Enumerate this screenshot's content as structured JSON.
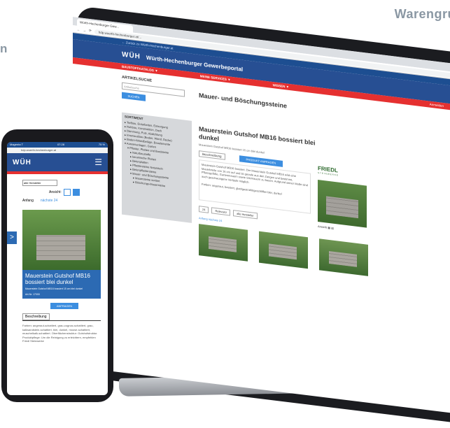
{
  "background": {
    "word": "Warengru",
    "letter": "n"
  },
  "desktop": {
    "tab_title": "Würth-Hechenburger Gew...",
    "url": "hdp.wuerth-hechenburger.at/...",
    "topnav_link": "Zurück zu Würth-Hechenburger.at",
    "logo": "WÜH",
    "portal_title": "Würth-Hechenburger Gewerbeportal",
    "menu": [
      "BAUSTOFFKATALOG ▼",
      "MEINE SERVICES ▼",
      "WISSEN ▼"
    ],
    "menu_right": "Anmelden",
    "sidebar": {
      "search_heading": "ARTIKELSUCHE",
      "search_placeholder": "Artikelsuche",
      "search_button": "SUCHEN",
      "sortiment_heading": "SORTIMENT",
      "sortiment_items": [
        "Tiefbau, Erdarbeiten, Entsorgung",
        "Rohbau, Konstruktion, Dach",
        "Dämmung, Putz, Abdichtung",
        "Innenausbau (Boden, Wand, Decke)",
        "Boden-/Wandbeläge, Bauelemente",
        "Aussenanlagen, Garten",
        "Pflaster, Platten und Bordsteine",
        "Naturbaustoffe",
        "keramische Platten",
        "Betonplatten",
        "Pflastersteine Naturstein",
        "Betonpflastersteine",
        "Mauer- und Böschungssteine",
        "Mauersteine sortiert",
        "Böschungs-Mauersteine"
      ]
    },
    "main": {
      "category_title": "Mauer- und Böschungssteine",
      "product_title": "Mauerstein Gutshof MB16 bossiert blei dunkel",
      "product_sub": "Mauerstein Gutshof MB16 bossiert 15 cm blei dunkel",
      "tab_description": "Beschreibung",
      "anfrage_button": "PRODUKT ANFRAGEN",
      "description": "Mauerstein Gutshof MB16 bossiert. Der Mauerstein Gutshof MB16 wird eine Mauerbreite von 16 cm auf und ist gerade aus den Zangen und bestimmt, Pflanzgefäße, Gartenmauern sowie Sitzmauern zu bauen. Aufgrund seiner Maße sind auch geschwungene Verläufe möglich.",
      "brand": "FRIEDL",
      "brand_sub": "STEINWERKE",
      "farbe_label": "Farben: angeraut, bossiert, glatt/gestrahlt/geschliffen blei, dunkel",
      "ctrl_count": "24",
      "ctrl_sort": "Relevanz",
      "ctrl_manufacturer": "alle Hersteller",
      "ansicht": "Ansicht",
      "paging": "Anfang  nächste 24"
    }
  },
  "mobile": {
    "status_left": "Magenta T",
    "status_time": "07:28",
    "status_right": "75 %",
    "url": "hdp.wuerth-hechenburger.at",
    "logo": "WÜH",
    "menu_icon": "☰",
    "select_value": "alle Hersteller",
    "ansicht": "Ansicht:",
    "paging_start": "Anfang",
    "paging_next": "nächste 24",
    "arrow": ">",
    "product_title": "Mauerstein Gutshof MB16 bossiert blei dunkel",
    "product_sub": "Mauerstein Gutshof MB16 bossiert 15 cm blei dunkel",
    "article_no": "Art.Nr: 17000",
    "anfrage_button": "ANFRAGEN",
    "tab_description": "Beschreibung",
    "description": "Farben: angeraut-schattiert, grau-cognac-schattiert, grau, kalksandstein-schattiert, blei, dunkel, moose-schattiert, muschelkalk-schattiert. Oberflächenstruktur: Gutshofstruktur. Produktpflege: Um die Reinigung zu erleichtern, empfehlen Friedl Steinwerke"
  },
  "colors": {
    "brand_blue": "#274f93",
    "accent_red": "#e53030",
    "button_blue": "#3c8ee0"
  }
}
